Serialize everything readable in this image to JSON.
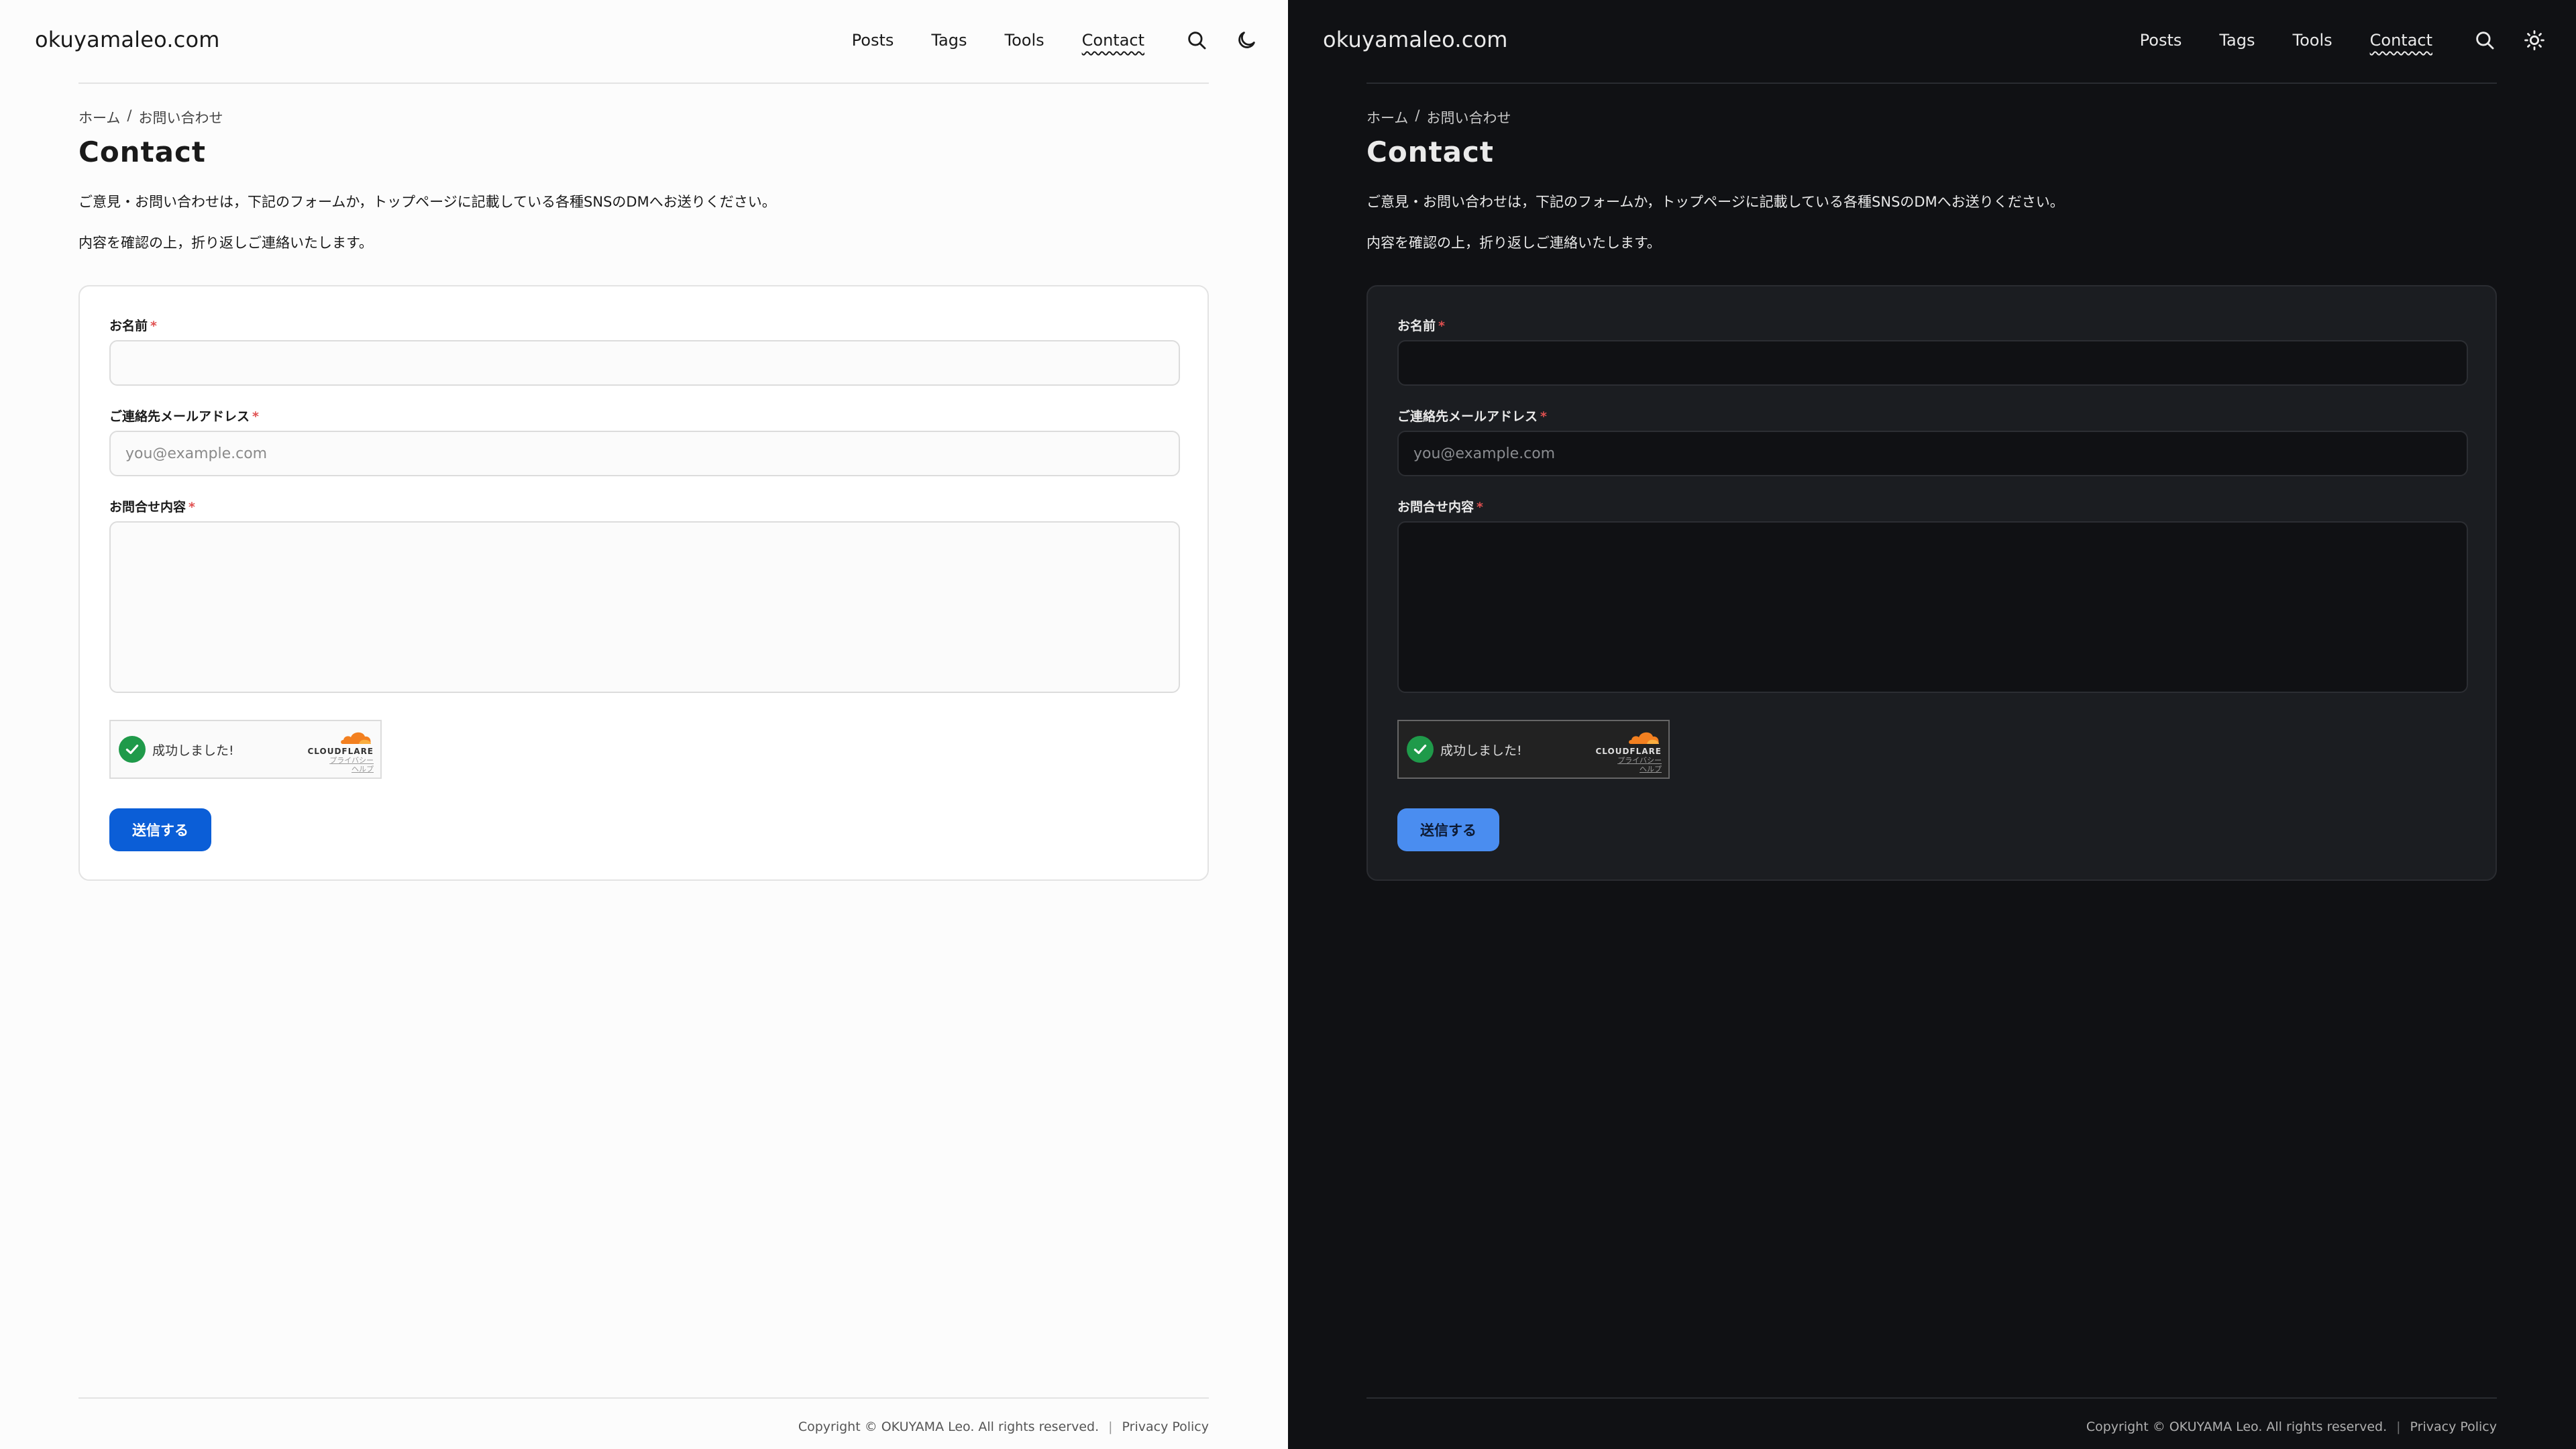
{
  "site": {
    "title": "okuyamaleo.com"
  },
  "nav": {
    "posts": "Posts",
    "tags": "Tags",
    "tools": "Tools",
    "contact": "Contact"
  },
  "breadcrumb": {
    "home": "ホーム",
    "separator": "/",
    "current": "お問い合わせ"
  },
  "page": {
    "title": "Contact",
    "lead": "ご意見・お問い合わせは，下記のフォームか，トップページに記載している各種SNSのDMへお送りください。",
    "lead2": "内容を確認の上，折り返しご連絡いたします。"
  },
  "form": {
    "name_label": "お名前",
    "email_label": "ご連絡先メールアドレス",
    "email_placeholder": "you@example.com",
    "message_label": "お問合せ内容",
    "required_mark": "*",
    "submit_label": "送信する"
  },
  "turnstile": {
    "status": "成功しました!",
    "brand": "CLOUDFLARE",
    "privacy": "プライバシー",
    "help": "ヘルプ"
  },
  "footer": {
    "copyright": "Copyright © OKUYAMA Leo. All rights reserved.",
    "separator": "|",
    "privacy": "Privacy Policy"
  },
  "icons": {
    "search": "search-icon",
    "light_theme_toggle": "moon-icon",
    "dark_theme_toggle": "sun-icon",
    "check": "check-icon",
    "cloud": "cloud-icon"
  },
  "colors": {
    "accent_light": "#0b5ed7",
    "accent_dark": "#4a8df0",
    "success": "#1f9a4a",
    "cloudflare": "#f38020"
  }
}
